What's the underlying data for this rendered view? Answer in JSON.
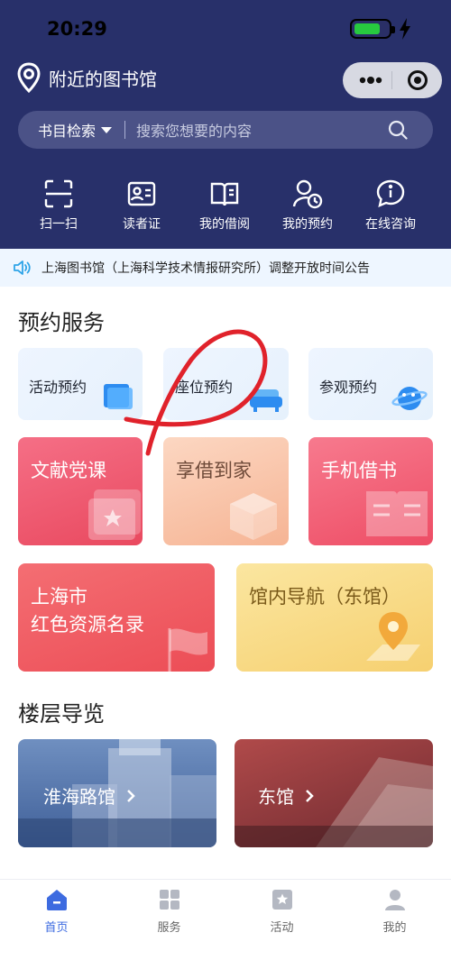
{
  "status_bar": {
    "time": "20:29"
  },
  "location": {
    "label": "附近的图书馆"
  },
  "search": {
    "category": "书目检索",
    "placeholder": "搜索您想要的内容"
  },
  "quick_actions": [
    {
      "label": "扫一扫",
      "icon": "scan-icon"
    },
    {
      "label": "读者证",
      "icon": "reader-card-icon"
    },
    {
      "label": "我的借阅",
      "icon": "book-icon"
    },
    {
      "label": "我的预约",
      "icon": "user-clock-icon"
    },
    {
      "label": "在线咨询",
      "icon": "chat-info-icon"
    }
  ],
  "notice": {
    "text": "上海图书馆（上海科学技术情报研究所）调整开放时间公告"
  },
  "reservation": {
    "title": "预约服务",
    "items": [
      "活动预约",
      "座位预约",
      "参观预约"
    ]
  },
  "services": {
    "wenxian": "文献党课",
    "xiangjie": "享借到家",
    "shouji": "手机借书",
    "red_line1": "上海市",
    "red_line2": "红色资源名录",
    "nav": "馆内导航（东馆）"
  },
  "floor": {
    "title": "楼层导览",
    "huaihai": "淮海路馆",
    "east": "东馆"
  },
  "tabbar": [
    {
      "label": "首页",
      "icon": "home-icon",
      "active": true
    },
    {
      "label": "服务",
      "icon": "grid-icon",
      "active": false
    },
    {
      "label": "活动",
      "icon": "star-badge-icon",
      "active": false
    },
    {
      "label": "我的",
      "icon": "profile-icon",
      "active": false
    }
  ],
  "colors": {
    "header": "#28306a",
    "accent": "#3d6be0",
    "annotation": "#e0222b"
  }
}
